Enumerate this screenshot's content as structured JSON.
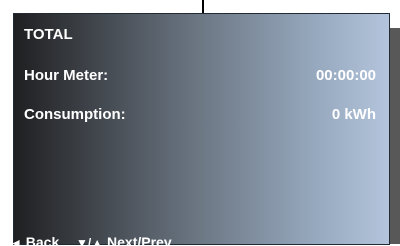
{
  "screen": {
    "title": "TOTAL",
    "rows": [
      {
        "label": "Hour Meter:",
        "value": "00:00:00"
      },
      {
        "label": "Consumption:",
        "value": "0 kWh"
      }
    ]
  },
  "footer": {
    "back_icon": "◄",
    "back_label": "Back",
    "nav_icon": "▼/▲",
    "nav_label": "Next/Prev"
  },
  "colors": {
    "gradient_left": "#1f1f21",
    "gradient_right": "#b3c4dc",
    "side_panel": "#585858",
    "text": "#ffffff"
  }
}
